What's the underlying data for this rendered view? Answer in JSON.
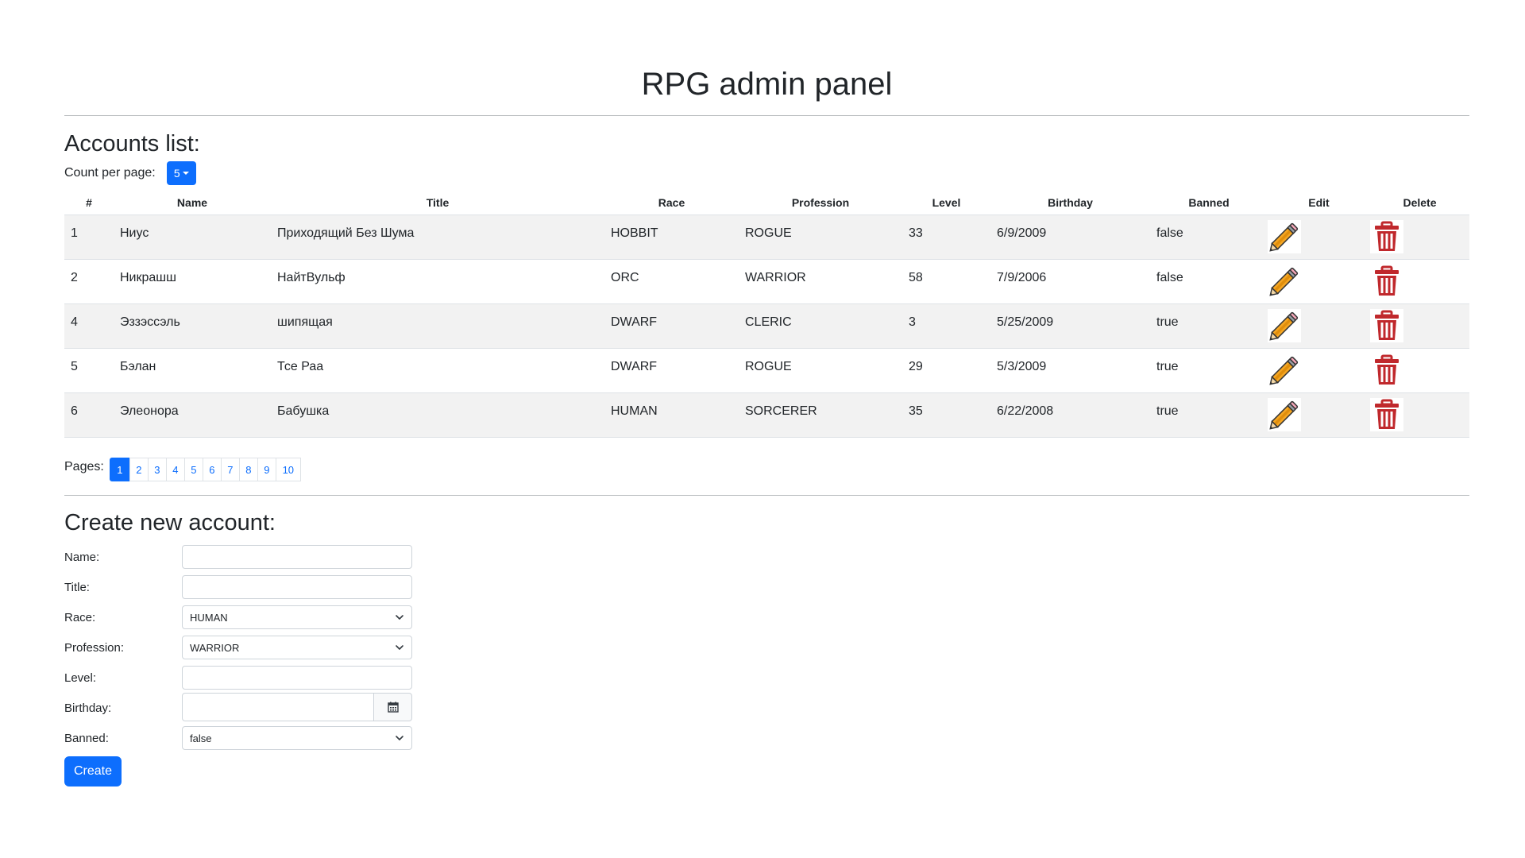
{
  "header": {
    "title": "RPG admin panel"
  },
  "accounts": {
    "heading": "Accounts list:",
    "count_label": "Count per page:",
    "count_value": "5",
    "columns": [
      "#",
      "Name",
      "Title",
      "Race",
      "Profession",
      "Level",
      "Birthday",
      "Banned",
      "Edit",
      "Delete"
    ],
    "rows": [
      {
        "id": "1",
        "name": "Ниус",
        "title": "Приходящий Без Шума",
        "race": "HOBBIT",
        "profession": "ROGUE",
        "level": "33",
        "birthday": "6/9/2009",
        "banned": "false"
      },
      {
        "id": "2",
        "name": "Никрашш",
        "title": "НайтВульф",
        "race": "ORC",
        "profession": "WARRIOR",
        "level": "58",
        "birthday": "7/9/2006",
        "banned": "false"
      },
      {
        "id": "4",
        "name": "Эззэссэль",
        "title": "шипящая",
        "race": "DWARF",
        "profession": "CLERIC",
        "level": "3",
        "birthday": "5/25/2009",
        "banned": "true"
      },
      {
        "id": "5",
        "name": "Бэлан",
        "title": "Тсе Раа",
        "race": "DWARF",
        "profession": "ROGUE",
        "level": "29",
        "birthday": "5/3/2009",
        "banned": "true"
      },
      {
        "id": "6",
        "name": "Элеонора",
        "title": "Бабушка",
        "race": "HUMAN",
        "profession": "SORCERER",
        "level": "35",
        "birthday": "6/22/2008",
        "banned": "true"
      }
    ],
    "pages_label": "Pages:",
    "pages": [
      "1",
      "2",
      "3",
      "4",
      "5",
      "6",
      "7",
      "8",
      "9",
      "10"
    ],
    "active_page": "1"
  },
  "create": {
    "heading": "Create new account:",
    "labels": {
      "name": "Name:",
      "title": "Title:",
      "race": "Race:",
      "profession": "Profession:",
      "level": "Level:",
      "birthday": "Birthday:",
      "banned": "Banned:"
    },
    "values": {
      "name": "",
      "title": "",
      "race": "HUMAN",
      "profession": "WARRIOR",
      "level": "",
      "birthday": "",
      "banned": "false"
    },
    "button_label": "Create"
  },
  "colors": {
    "primary": "#0d6efd",
    "delete_icon": "#c0282c",
    "pencil_body": "#f5a623"
  },
  "icons": {
    "edit": "pencil-icon",
    "delete": "trash-icon",
    "date": "calendar-icon",
    "select": "chevron-down-icon",
    "dropdown": "caret-down-icon"
  }
}
